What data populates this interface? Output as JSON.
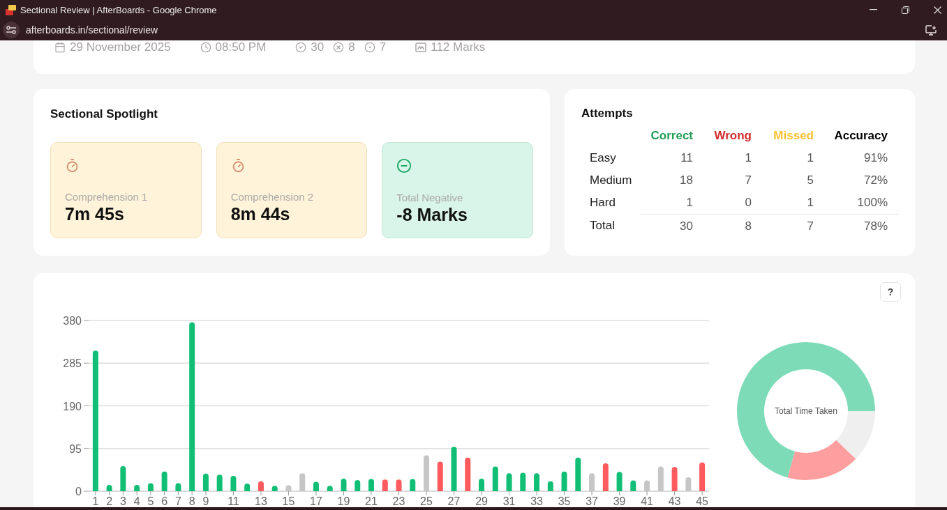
{
  "browser": {
    "title": "Sectional Review | AfterBoards - Google Chrome",
    "url": "afterboards.in/sectional/review"
  },
  "summary": {
    "items": [
      {
        "kind": "date",
        "text": "29 November 2025"
      },
      {
        "kind": "time",
        "text": "08:50 PM"
      },
      {
        "kind": "correct",
        "text": "30"
      },
      {
        "kind": "wrong",
        "text": "8"
      },
      {
        "kind": "missed",
        "text": "7"
      },
      {
        "kind": "marks",
        "text": "112 Marks"
      }
    ]
  },
  "spotlight": {
    "title": "Sectional Spotlight",
    "tiles": [
      {
        "kind": "timer",
        "label": "Comprehension 1",
        "value": "7m 45s"
      },
      {
        "kind": "timer",
        "label": "Comprehension 2",
        "value": "8m 44s"
      },
      {
        "kind": "negative",
        "label": "Total Negative",
        "value": "-8 Marks"
      }
    ]
  },
  "attempts": {
    "title": "Attempts",
    "columns": [
      {
        "label": "Correct",
        "color": "#1f9e56"
      },
      {
        "label": "Wrong",
        "color": "#d42c2c"
      },
      {
        "label": "Missed",
        "color": "#f7c131"
      },
      {
        "label": "Accuracy",
        "color": "#000000"
      }
    ],
    "rows": [
      {
        "kind": "level",
        "label": "Easy",
        "cells": [
          "11",
          "1",
          "1",
          "91%"
        ]
      },
      {
        "kind": "level",
        "label": "Medium",
        "cells": [
          "18",
          "7",
          "5",
          "72%"
        ]
      },
      {
        "kind": "level",
        "label": "Hard",
        "cells": [
          "1",
          "0",
          "1",
          "100%"
        ]
      },
      {
        "kind": "total",
        "label": "Total",
        "cells": [
          "30",
          "8",
          "7",
          "78%"
        ]
      }
    ]
  },
  "performance": {
    "help": "?",
    "chart_data": {
      "type": "bar",
      "x": [
        1,
        2,
        3,
        4,
        5,
        6,
        7,
        8,
        9,
        10,
        11,
        12,
        13,
        14,
        15,
        16,
        17,
        18,
        19,
        20,
        21,
        22,
        23,
        24,
        25,
        26,
        27,
        28,
        29,
        30,
        31,
        32,
        33,
        34,
        35,
        36,
        37,
        38,
        39,
        40,
        41,
        42,
        43,
        44,
        45
      ],
      "series": [
        {
          "color": "#10bf75",
          "values": [
            313,
            14,
            56,
            14,
            18,
            44,
            18,
            376,
            39,
            37,
            34,
            17,
            null,
            12,
            null,
            null,
            21,
            12,
            28,
            25,
            27,
            null,
            null,
            27,
            null,
            null,
            99,
            null,
            28,
            55,
            40,
            41,
            40,
            22,
            44,
            75,
            null,
            null,
            43,
            24,
            null,
            null,
            null,
            null,
            null
          ]
        },
        {
          "color": "#ff5a5e",
          "values": [
            null,
            null,
            null,
            null,
            null,
            null,
            null,
            null,
            null,
            null,
            null,
            null,
            22,
            null,
            null,
            null,
            null,
            null,
            null,
            null,
            null,
            26,
            26,
            null,
            null,
            66,
            null,
            75,
            null,
            null,
            null,
            null,
            null,
            null,
            null,
            null,
            null,
            62,
            null,
            null,
            null,
            null,
            54,
            null,
            64
          ]
        },
        {
          "color": "#c6c6c6",
          "values": [
            null,
            null,
            null,
            null,
            null,
            null,
            null,
            null,
            null,
            null,
            null,
            null,
            null,
            null,
            13,
            40,
            null,
            null,
            null,
            null,
            null,
            null,
            null,
            null,
            80,
            null,
            null,
            null,
            null,
            null,
            null,
            null,
            null,
            null,
            null,
            null,
            40,
            null,
            null,
            null,
            24,
            55,
            null,
            31,
            null
          ]
        }
      ],
      "stacked": true,
      "grid": true,
      "xlim": [
        0.5,
        45.5
      ],
      "ylim": [
        0,
        380
      ],
      "yticks": [
        0,
        95,
        190,
        285,
        380
      ],
      "xticks": [
        1,
        2,
        3,
        4,
        5,
        6,
        7,
        8,
        9,
        11,
        13,
        15,
        17,
        19,
        21,
        23,
        25,
        27,
        29,
        31,
        33,
        35,
        37,
        39,
        41,
        43,
        45
      ]
    },
    "donut": {
      "label": "Total Time Taken"
    }
  }
}
